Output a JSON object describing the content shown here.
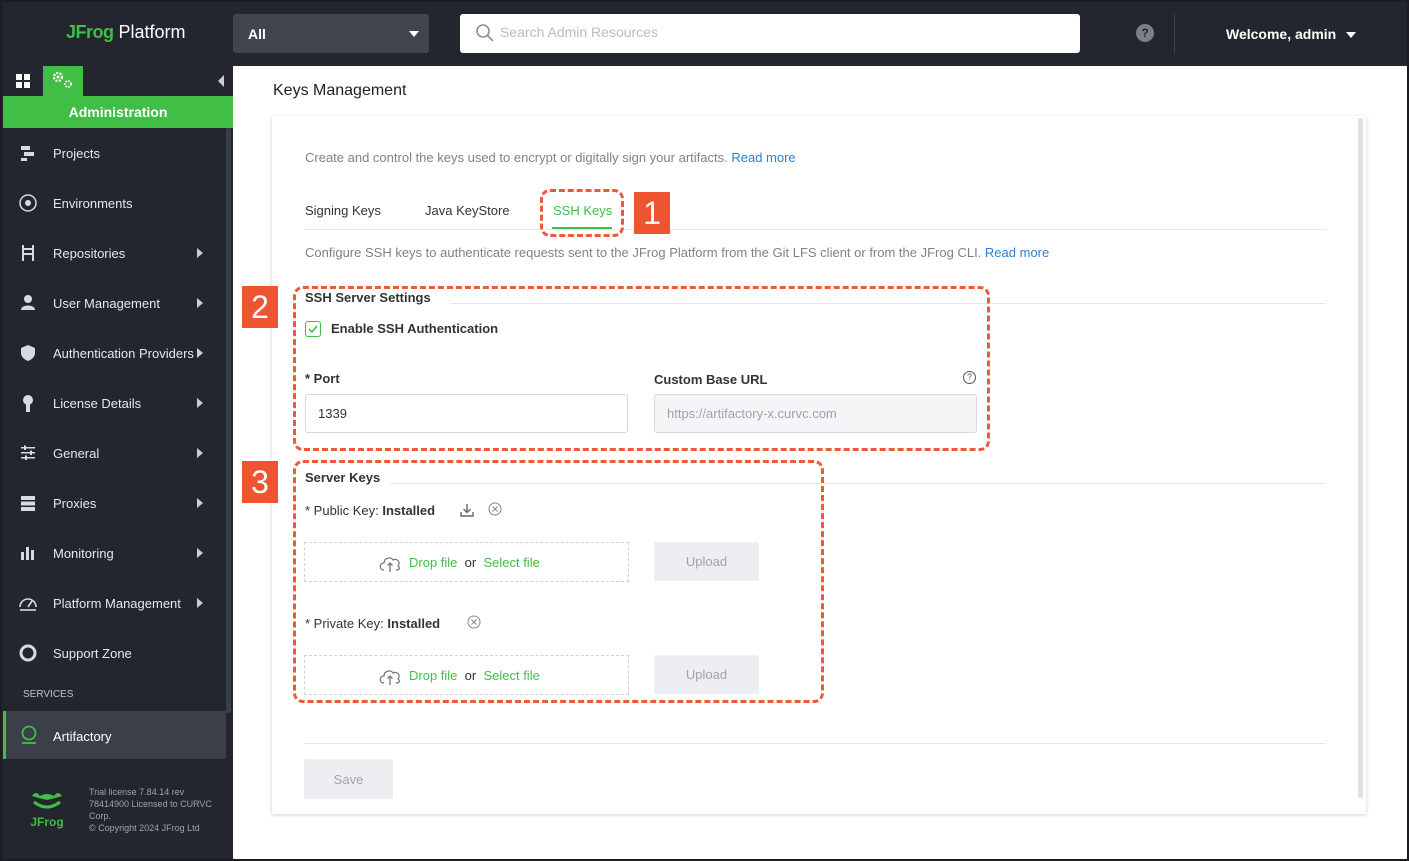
{
  "topbar": {
    "logo_brand": "JFrog",
    "logo_product": "Platform",
    "scope": "All",
    "search_placeholder": "Search Admin Resources",
    "help": "?",
    "welcome": "Welcome, admin"
  },
  "sidebar": {
    "section_title": "Administration",
    "items": [
      {
        "label": "Projects",
        "icon": "projects-icon",
        "has_submenu": false
      },
      {
        "label": "Environments",
        "icon": "environments-icon",
        "has_submenu": false
      },
      {
        "label": "Repositories",
        "icon": "repositories-icon",
        "has_submenu": true
      },
      {
        "label": "User Management",
        "icon": "user-icon",
        "has_submenu": true
      },
      {
        "label": "Authentication Providers",
        "icon": "shield-icon",
        "has_submenu": true
      },
      {
        "label": "License Details",
        "icon": "ribbon-icon",
        "has_submenu": true
      },
      {
        "label": "General",
        "icon": "sliders-icon",
        "has_submenu": true
      },
      {
        "label": "Proxies",
        "icon": "server-icon",
        "has_submenu": true
      },
      {
        "label": "Monitoring",
        "icon": "bar-chart-icon",
        "has_submenu": true
      },
      {
        "label": "Platform Management",
        "icon": "gauge-icon",
        "has_submenu": true
      },
      {
        "label": "Support Zone",
        "icon": "lifebuoy-icon",
        "has_submenu": false
      }
    ],
    "services_label": "SERVICES",
    "service_item": "Artifactory",
    "license_lines": [
      "Trial license 7.84.14 rev",
      "78414900 Licensed to CURVC",
      "Corp.",
      "© Copyright 2024 JFrog Ltd"
    ],
    "footer_logo": "JFrog"
  },
  "main": {
    "page_title": "Keys Management",
    "intro_text": "Create and control the keys used to encrypt or digitally sign your artifacts.",
    "read_more": "Read more",
    "tabs": [
      "Signing Keys",
      "Java KeyStore",
      "SSH Keys"
    ],
    "active_tab": "SSH Keys",
    "ssh_intro": "Configure SSH keys to authenticate requests sent to the JFrog Platform from the Git LFS client or from the JFrog CLI.",
    "ssh_settings": {
      "title": "SSH Server Settings",
      "enable_label": "Enable SSH Authentication",
      "enabled": true,
      "port_label": "* Port",
      "port_value": "1339",
      "base_url_label": "Custom Base URL",
      "base_url_placeholder": "https://artifactory-x.curvc.com"
    },
    "server_keys": {
      "title": "Server Keys",
      "public_prefix": "* Public Key:",
      "public_status": "Installed",
      "private_prefix": "* Private Key:",
      "private_status": "Installed",
      "drop_text": "Drop file",
      "or_text": "or",
      "select_text": "Select file",
      "upload_label": "Upload"
    },
    "save_label": "Save"
  },
  "annotations": [
    "1",
    "2",
    "3"
  ],
  "colors": {
    "accent": "#40be46",
    "topbar": "#23262e",
    "link": "#2a7fd4",
    "annotation": "#ef5430"
  }
}
